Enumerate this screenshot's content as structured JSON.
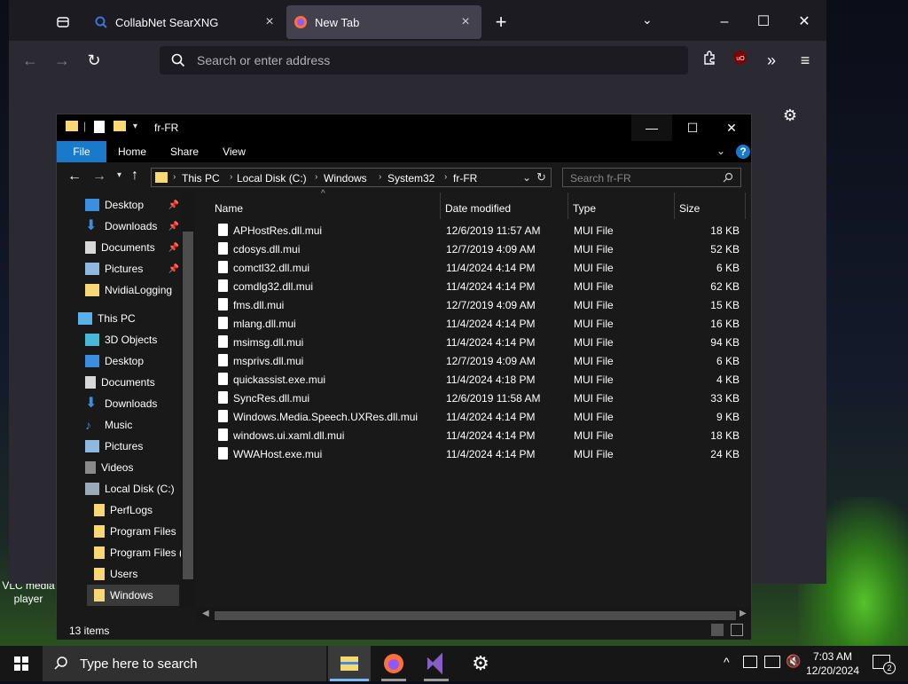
{
  "browser": {
    "tabs": [
      {
        "label": "CollabNet SearXNG",
        "icon": "searxng-icon"
      },
      {
        "label": "New Tab",
        "icon": "firefox-icon"
      }
    ],
    "url_placeholder": "Search or enter address"
  },
  "explorer": {
    "title": "fr-FR",
    "ribbon_tabs": [
      "File",
      "Home",
      "Share",
      "View"
    ],
    "breadcrumb": [
      "This PC",
      "Local Disk (C:)",
      "Windows",
      "System32",
      "fr-FR"
    ],
    "search_placeholder": "Search fr-FR",
    "nav": [
      {
        "label": "Desktop",
        "icon": "desktop-icon",
        "pinned": true
      },
      {
        "label": "Downloads",
        "icon": "downloads-icon",
        "pinned": true
      },
      {
        "label": "Documents",
        "icon": "documents-icon",
        "pinned": true
      },
      {
        "label": "Pictures",
        "icon": "pictures-icon",
        "pinned": true
      },
      {
        "label": "NvidiaLogging",
        "icon": "folder-icon",
        "pinned": false
      },
      {
        "label": "This PC",
        "icon": "this-pc-icon",
        "pinned": false
      },
      {
        "label": "3D Objects",
        "icon": "3d-objects-icon",
        "pinned": false
      },
      {
        "label": "Desktop",
        "icon": "desktop-icon",
        "pinned": false
      },
      {
        "label": "Documents",
        "icon": "documents-icon",
        "pinned": false
      },
      {
        "label": "Downloads",
        "icon": "downloads-icon",
        "pinned": false
      },
      {
        "label": "Music",
        "icon": "music-icon",
        "pinned": false
      },
      {
        "label": "Pictures",
        "icon": "pictures-icon",
        "pinned": false
      },
      {
        "label": "Videos",
        "icon": "videos-icon",
        "pinned": false
      },
      {
        "label": "Local Disk (C:)",
        "icon": "drive-icon",
        "pinned": false
      },
      {
        "label": "PerfLogs",
        "icon": "folder-icon",
        "pinned": false
      },
      {
        "label": "Program Files",
        "icon": "folder-icon",
        "pinned": false
      },
      {
        "label": "Program Files (",
        "icon": "folder-icon",
        "pinned": false
      },
      {
        "label": "Users",
        "icon": "folder-icon",
        "pinned": false
      },
      {
        "label": "Windows",
        "icon": "folder-icon",
        "pinned": false,
        "selected": true
      }
    ],
    "columns": [
      "Name",
      "Date modified",
      "Type",
      "Size"
    ],
    "files": [
      {
        "name": "APHostRes.dll.mui",
        "date": "12/6/2019 11:57 AM",
        "type": "MUI File",
        "size": "18 KB"
      },
      {
        "name": "cdosys.dll.mui",
        "date": "12/7/2019 4:09 AM",
        "type": "MUI File",
        "size": "52 KB"
      },
      {
        "name": "comctl32.dll.mui",
        "date": "11/4/2024 4:14 PM",
        "type": "MUI File",
        "size": "6 KB"
      },
      {
        "name": "comdlg32.dll.mui",
        "date": "11/4/2024 4:14 PM",
        "type": "MUI File",
        "size": "62 KB"
      },
      {
        "name": "fms.dll.mui",
        "date": "12/7/2019 4:09 AM",
        "type": "MUI File",
        "size": "15 KB"
      },
      {
        "name": "mlang.dll.mui",
        "date": "11/4/2024 4:14 PM",
        "type": "MUI File",
        "size": "16 KB"
      },
      {
        "name": "msimsg.dll.mui",
        "date": "11/4/2024 4:14 PM",
        "type": "MUI File",
        "size": "94 KB"
      },
      {
        "name": "msprivs.dll.mui",
        "date": "12/7/2019 4:09 AM",
        "type": "MUI File",
        "size": "6 KB"
      },
      {
        "name": "quickassist.exe.mui",
        "date": "11/4/2024 4:18 PM",
        "type": "MUI File",
        "size": "4 KB"
      },
      {
        "name": "SyncRes.dll.mui",
        "date": "12/6/2019 11:58 AM",
        "type": "MUI File",
        "size": "33 KB"
      },
      {
        "name": "Windows.Media.Speech.UXRes.dll.mui",
        "date": "11/4/2024 4:14 PM",
        "type": "MUI File",
        "size": "9 KB"
      },
      {
        "name": "windows.ui.xaml.dll.mui",
        "date": "11/4/2024 4:14 PM",
        "type": "MUI File",
        "size": "18 KB"
      },
      {
        "name": "WWAHost.exe.mui",
        "date": "11/4/2024 4:14 PM",
        "type": "MUI File",
        "size": "24 KB"
      }
    ],
    "status": "13 items"
  },
  "desktop": {
    "vlc_label": "VLC media player"
  },
  "taskbar": {
    "search_placeholder": "Type here to search",
    "time": "7:03 AM",
    "date": "12/20/2024",
    "notification_count": "2"
  },
  "colors": {
    "accent": "#1979ca",
    "folder": "#f8d775"
  }
}
